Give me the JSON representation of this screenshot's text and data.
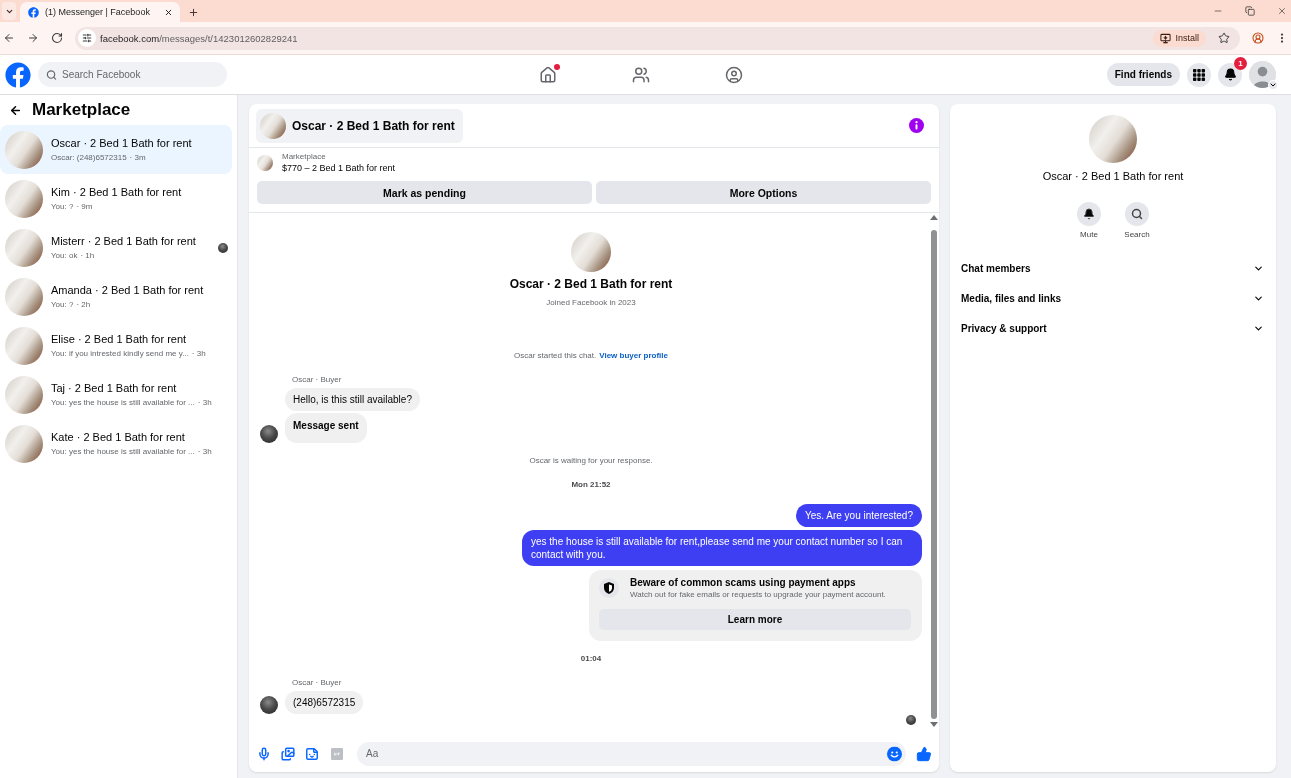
{
  "browser": {
    "tabs": [
      {
        "title": "(1) Messenger | Facebook",
        "selected": true
      }
    ],
    "url_host": "facebook.com",
    "url_path": "/messages/t/1423012602829241",
    "install_label": "Install"
  },
  "header": {
    "search_placeholder": "Search Facebook",
    "nav": [
      {
        "notification_dot": true
      },
      {
        "notification_dot": false
      },
      {
        "notification_dot": false
      }
    ],
    "find_friends": "Find friends",
    "notifications_badge": "1"
  },
  "sidebar": {
    "title": "Marketplace",
    "chats": [
      {
        "name": "Oscar · 2 Bed 1 Bath for rent",
        "preview": "Oscar: (248)6572315",
        "time": "· 3m",
        "selected": true,
        "seen_avatar": false
      },
      {
        "name": "Kim · 2 Bed 1 Bath for rent",
        "preview": "You: ?",
        "time": "· 9m",
        "selected": false,
        "seen_avatar": false
      },
      {
        "name": "Misterr · 2 Bed 1 Bath for rent",
        "preview": "You: ok",
        "time": "· 1h",
        "selected": false,
        "seen_avatar": true
      },
      {
        "name": "Amanda · 2 Bed 1 Bath for rent",
        "preview": "You: ?",
        "time": "· 2h",
        "selected": false,
        "seen_avatar": false
      },
      {
        "name": "Elise · 2 Bed 1 Bath for rent",
        "preview": "You: if you intrested kindly send me y...",
        "time": "· 3h",
        "selected": false,
        "seen_avatar": false
      },
      {
        "name": "Taj · 2 Bed 1 Bath for rent",
        "preview": "You: yes the house is still available for ...",
        "time": "· 3h",
        "selected": false,
        "seen_avatar": false
      },
      {
        "name": "Kate · 2 Bed 1 Bath for rent",
        "preview": "You: yes the house is still available for ...",
        "time": "· 3h",
        "selected": false,
        "seen_avatar": false
      }
    ]
  },
  "chat": {
    "title": "Oscar · 2 Bed 1 Bath for rent",
    "listing": {
      "label": "Marketplace",
      "title": "$770 – 2 Bed 1 Bath for rent"
    },
    "actions": [
      "Mark as pending",
      "More Options"
    ],
    "profile": {
      "name": "Oscar · 2 Bed 1 Bath for rent",
      "joined": "Joined Facebook in 2023"
    },
    "messages": [
      {
        "kind": "notice",
        "text": "Oscar started this chat.",
        "link": "View buyer profile"
      },
      {
        "kind": "incoming",
        "sender": "Oscar · Buyer",
        "bubbles": [
          {
            "text": "Hello, is this still available?",
            "bold": false
          },
          {
            "text": "Message sent",
            "bold": true
          }
        ]
      },
      {
        "kind": "notice",
        "text": "Oscar is waiting for your response."
      },
      {
        "kind": "timestamp",
        "text": "Mon 21:52"
      },
      {
        "kind": "outgoing",
        "bubbles": [
          {
            "text": "Yes. Are you interested?"
          },
          {
            "text": "yes the house is still available for rent,please send me your contact number so I can contact with you."
          }
        ]
      },
      {
        "kind": "safety_notice",
        "title": "Beware of common scams using payment apps",
        "body": "Watch out for fake emails or requests to upgrade your payment account.",
        "button": "Learn more"
      },
      {
        "kind": "timestamp",
        "text": "01:04"
      },
      {
        "kind": "incoming",
        "sender": "Oscar · Buyer",
        "bubbles": [
          {
            "text": "(248)6572315",
            "bold": false
          }
        ]
      }
    ],
    "seen": true,
    "composer": {
      "placeholder": "Aa"
    }
  },
  "details": {
    "name": "Oscar · 2 Bed 1 Bath for rent",
    "actions": [
      {
        "label": "Mute"
      },
      {
        "label": "Search"
      }
    ],
    "sections": [
      {
        "label": "Chat members",
        "expanded": false
      },
      {
        "label": "Media, files and links",
        "expanded": false
      },
      {
        "label": "Privacy & support",
        "expanded": false
      }
    ]
  }
}
